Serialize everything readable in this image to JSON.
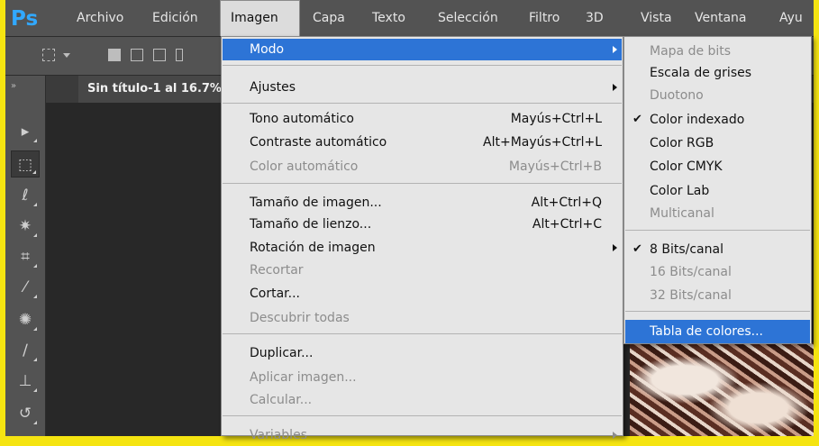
{
  "app": {
    "logo": "Ps"
  },
  "menubar": {
    "items": [
      "Archivo",
      "Edición",
      "Imagen",
      "Capa",
      "Texto",
      "Selección",
      "Filtro",
      "3D",
      "Vista",
      "Ventana",
      "Ayu"
    ],
    "active": "Imagen"
  },
  "document": {
    "tab_title": "Sin título-1 al 16.7%"
  },
  "toolbox": {
    "collapse_glyph": "»",
    "tools": [
      {
        "icon": "move-tool-icon",
        "glyph": "▸"
      },
      {
        "icon": "marquee-tool-icon",
        "glyph": "⬚"
      },
      {
        "icon": "lasso-tool-icon",
        "glyph": "ℓ"
      },
      {
        "icon": "magic-wand-tool-icon",
        "glyph": "✷"
      },
      {
        "icon": "crop-tool-icon",
        "glyph": "⌗"
      },
      {
        "icon": "eyedropper-tool-icon",
        "glyph": "⁄"
      },
      {
        "icon": "healing-brush-tool-icon",
        "glyph": "✺"
      },
      {
        "icon": "brush-tool-icon",
        "glyph": "∕"
      },
      {
        "icon": "stamp-tool-icon",
        "glyph": "⊥"
      },
      {
        "icon": "history-brush-tool-icon",
        "glyph": "↺"
      }
    ]
  },
  "image_menu": {
    "items": [
      {
        "label": "Modo",
        "shortcut": "",
        "submenu": true,
        "disabled": false,
        "highlighted": true
      },
      {
        "label": "Ajustes",
        "shortcut": "",
        "submenu": true,
        "disabled": false
      },
      {
        "label": "Tono automático",
        "shortcut": "Mayús+Ctrl+L",
        "submenu": false,
        "disabled": false
      },
      {
        "label": "Contraste automático",
        "shortcut": "Alt+Mayús+Ctrl+L",
        "submenu": false,
        "disabled": false
      },
      {
        "label": "Color automático",
        "shortcut": "Mayús+Ctrl+B",
        "submenu": false,
        "disabled": true
      },
      {
        "label": "Tamaño de imagen...",
        "shortcut": "Alt+Ctrl+Q",
        "submenu": false,
        "disabled": false
      },
      {
        "label": "Tamaño de lienzo...",
        "shortcut": "Alt+Ctrl+C",
        "submenu": false,
        "disabled": false
      },
      {
        "label": "Rotación de imagen",
        "shortcut": "",
        "submenu": true,
        "disabled": false
      },
      {
        "label": "Recortar",
        "shortcut": "",
        "submenu": false,
        "disabled": true
      },
      {
        "label": "Cortar...",
        "shortcut": "",
        "submenu": false,
        "disabled": false
      },
      {
        "label": "Descubrir todas",
        "shortcut": "",
        "submenu": false,
        "disabled": true
      },
      {
        "label": "Duplicar...",
        "shortcut": "",
        "submenu": false,
        "disabled": false
      },
      {
        "label": "Aplicar imagen...",
        "shortcut": "",
        "submenu": false,
        "disabled": true
      },
      {
        "label": "Calcular...",
        "shortcut": "",
        "submenu": false,
        "disabled": true
      },
      {
        "label": "Variables",
        "shortcut": "",
        "submenu": true,
        "disabled": true
      }
    ]
  },
  "mode_submenu": {
    "items": [
      {
        "label": "Mapa de bits",
        "checked": false,
        "disabled": true
      },
      {
        "label": "Escala de grises",
        "checked": false,
        "disabled": false
      },
      {
        "label": "Duotono",
        "checked": false,
        "disabled": true
      },
      {
        "label": "Color indexado",
        "checked": true,
        "disabled": false
      },
      {
        "label": "Color RGB",
        "checked": false,
        "disabled": false
      },
      {
        "label": "Color CMYK",
        "checked": false,
        "disabled": false
      },
      {
        "label": "Color Lab",
        "checked": false,
        "disabled": false
      },
      {
        "label": "Multicanal",
        "checked": false,
        "disabled": true
      },
      {
        "label": "8 Bits/canal",
        "checked": true,
        "disabled": false
      },
      {
        "label": "16 Bits/canal",
        "checked": false,
        "disabled": true
      },
      {
        "label": "32 Bits/canal",
        "checked": false,
        "disabled": true
      },
      {
        "label": "Tabla de colores...",
        "checked": false,
        "disabled": false,
        "highlighted": true
      }
    ],
    "check_glyph": "✔"
  },
  "colors": {
    "highlight": "#2d74d6",
    "menu_bg": "#e6e6e6",
    "ps_blue": "#31a8ff",
    "frame_yellow": "#f5e411"
  }
}
